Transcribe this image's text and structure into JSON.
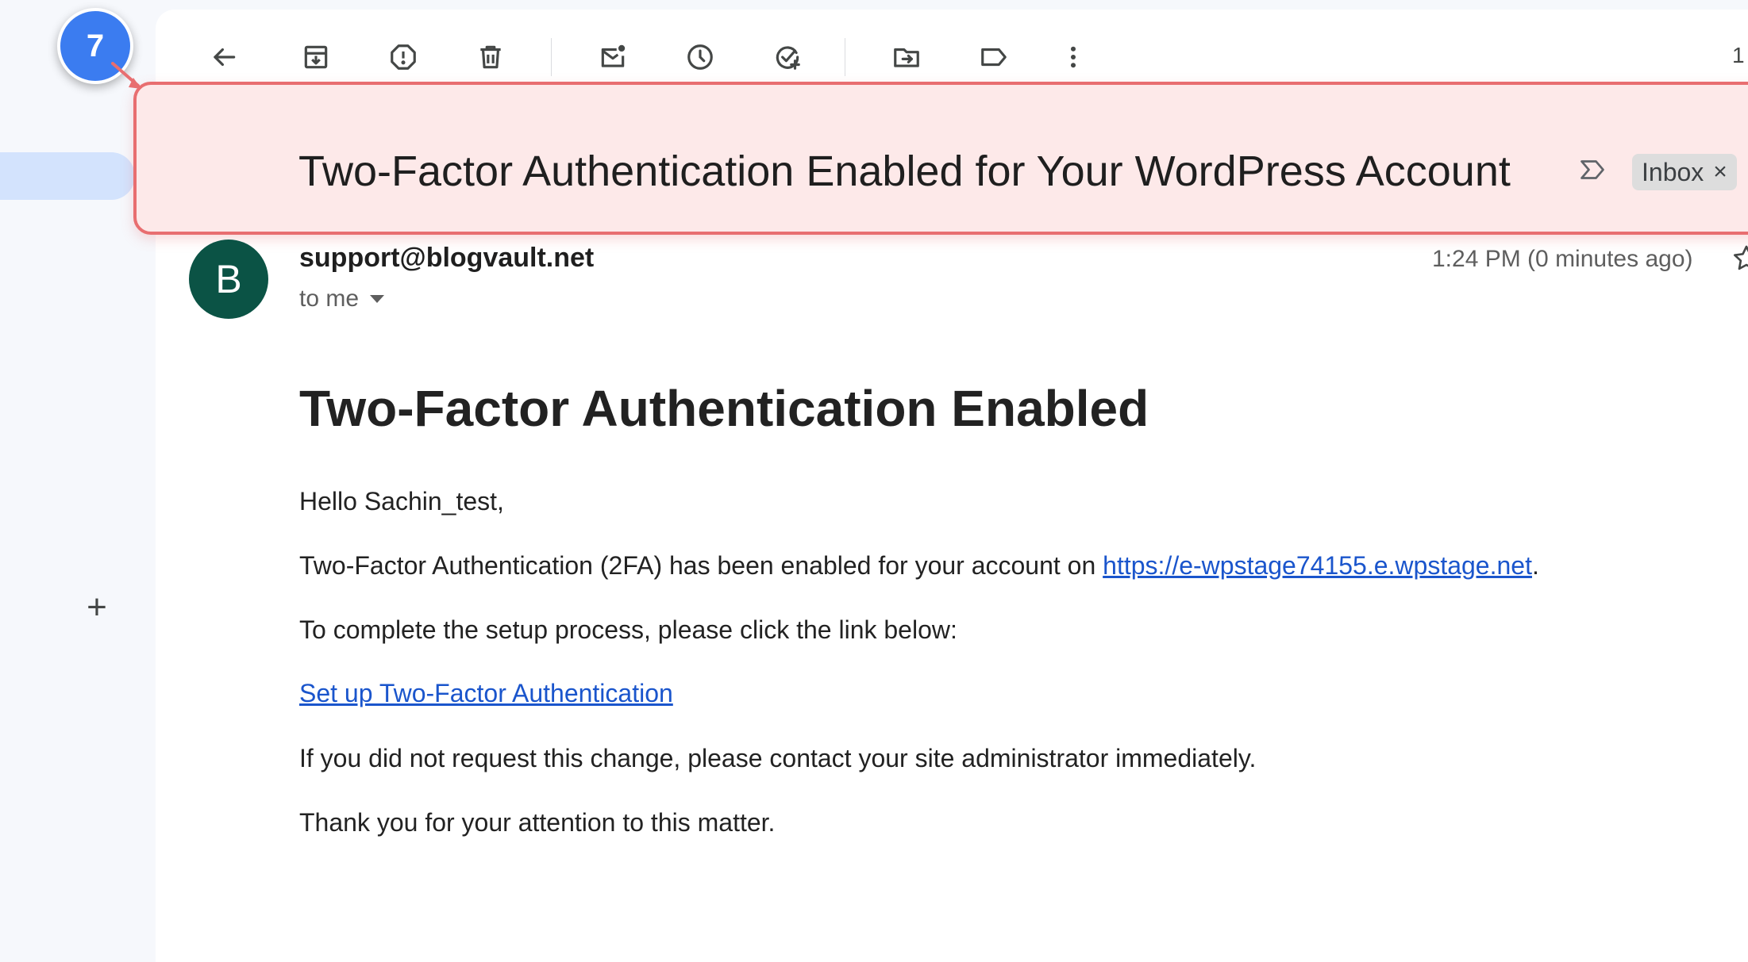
{
  "toolbar": {
    "actions": [
      {
        "name": "back",
        "icon": "arrow-left-icon"
      },
      {
        "name": "archive",
        "icon": "archive-icon"
      },
      {
        "name": "report-spam",
        "icon": "report-spam-icon"
      },
      {
        "name": "delete",
        "icon": "trash-icon"
      },
      {
        "name": "mark-unread",
        "icon": "mark-unread-icon"
      },
      {
        "name": "snooze",
        "icon": "clock-icon"
      },
      {
        "name": "add-to-tasks",
        "icon": "add-task-icon"
      },
      {
        "name": "move-to",
        "icon": "move-to-folder-icon"
      },
      {
        "name": "labels",
        "icon": "label-icon"
      },
      {
        "name": "more",
        "icon": "more-vert-icon"
      }
    ],
    "count_text": "1"
  },
  "sidebar": {
    "add_label_icon": "plus-icon"
  },
  "step_badge": "7",
  "email": {
    "subject": "Two-Factor Authentication Enabled for Your WordPress Account",
    "label_chip": "Inbox",
    "label_chip_close": "×",
    "sender_initial": "B",
    "sender": "support@blogvault.net",
    "to": "to me",
    "timestamp": "1:24 PM (0 minutes ago)",
    "body": {
      "heading": "Two-Factor Authentication Enabled",
      "greeting": "Hello Sachin_test,",
      "line1_prefix": "Two-Factor Authentication (2FA) has been enabled for your account on ",
      "line1_link": "https://e-wpstage74155.e.wpstage.net",
      "line1_suffix": ".",
      "line2": "To complete the setup process, please click the link below:",
      "setup_link": "Set up Two-Factor Authentication",
      "line3": "If you did not request this change, please contact your site administrator immediately.",
      "line4": "Thank you for your attention to this matter."
    }
  },
  "colors": {
    "highlight_border": "#e86e70",
    "highlight_fill": "#fde9e9",
    "badge": "#3b7cf0",
    "avatar": "#0b5345",
    "link": "#1a55cc",
    "nav_active": "#d3e3fd"
  }
}
